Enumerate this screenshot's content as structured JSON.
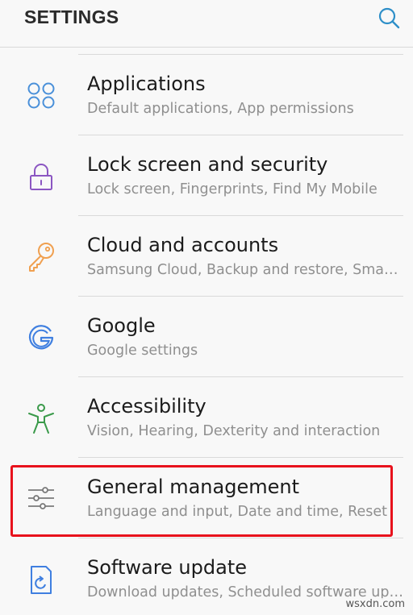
{
  "header": {
    "title": "SETTINGS",
    "search_icon": "search-icon"
  },
  "items": [
    {
      "label": "Applications",
      "sub": "Default applications, App permissions",
      "icon": "apps-grid-icon"
    },
    {
      "label": "Lock screen and security",
      "sub": "Lock screen, Fingerprints, Find My Mobile",
      "icon": "lock-icon"
    },
    {
      "label": "Cloud and accounts",
      "sub": "Samsung Cloud, Backup and restore, Smart Switch",
      "icon": "key-icon"
    },
    {
      "label": "Google",
      "sub": "Google settings",
      "icon": "google-icon"
    },
    {
      "label": "Accessibility",
      "sub": "Vision, Hearing, Dexterity and interaction",
      "icon": "accessibility-icon"
    },
    {
      "label": "General management",
      "sub": "Language and input, Date and time, Reset",
      "icon": "sliders-icon"
    },
    {
      "label": "Software update",
      "sub": "Download updates, Scheduled software updates",
      "icon": "software-update-icon"
    }
  ],
  "highlighted_item": "General management",
  "colors": {
    "apps": "#4a90d9",
    "lock": "#8b56c2",
    "key": "#f0a050",
    "google": "#3f7fe0",
    "accessibility": "#3a9a4a",
    "sliders": "#7a7a7a",
    "update": "#3f7fe0",
    "highlight": "#e8121c"
  },
  "watermark": "wsxdn.com"
}
